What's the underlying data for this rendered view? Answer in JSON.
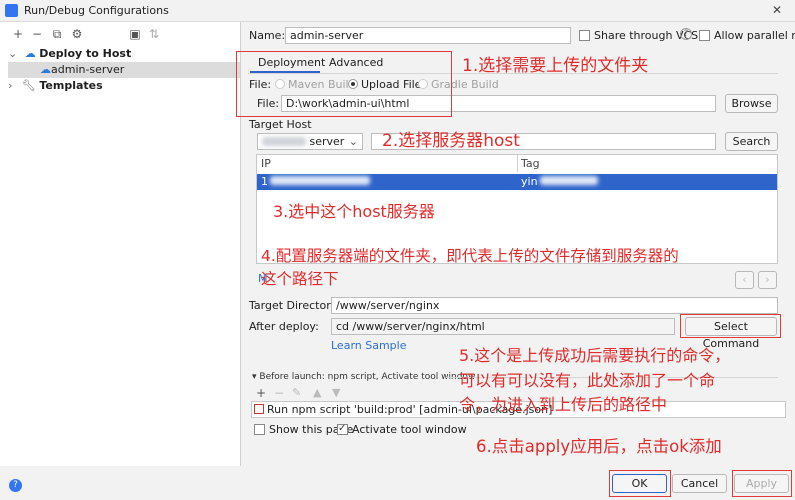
{
  "window": {
    "title": "Run/Debug Configurations",
    "close_glyph": "✕"
  },
  "toolbar": {
    "add": "+",
    "remove": "−",
    "copy": "⧉",
    "edit": "⚙",
    "folder": "▣",
    "sort": "⇅"
  },
  "tree": {
    "deploy_to_host": "Deploy to Host",
    "admin_server": "admin-server",
    "templates": "Templates"
  },
  "form": {
    "name_label": "Name:",
    "name_value": "admin-server",
    "share_vcs": "Share through VCS",
    "allow_parallel": "Allow parallel run",
    "help_glyph": "?",
    "tabs": [
      "Deployment",
      "Advanced"
    ],
    "file_label": "File:",
    "file_options": [
      "Maven Build",
      "Upload File",
      "Gradle Build"
    ],
    "file_path_label": "File:",
    "file_path_value": "D:\\work\\admin-ui\\html",
    "browse": "Browse",
    "target_host_label": "Target Host",
    "host_select_suffix": "server",
    "search": "Search",
    "table_headers": [
      "IP",
      "Tag"
    ],
    "row_ip_prefix": "1",
    "row_tag_prefix": "yin",
    "manage_link": "M",
    "target_dir_label": "Target Directory:",
    "target_dir_value": "/www/server/nginx",
    "after_deploy_label": "After deploy:",
    "after_deploy_value": "cd /www/server/nginx/html",
    "select_command": "Select Command",
    "learn_sample": "Learn Sample",
    "before_launch": "Before launch: npm script, Activate tool window",
    "npm_task": "Run npm script 'build:prod' [admin-ui\\package.json]",
    "show_page": "Show this page",
    "activate_tool": "Activate tool window"
  },
  "footer": {
    "ok": "OK",
    "cancel": "Cancel",
    "apply": "Apply",
    "help": "?"
  },
  "annotations": {
    "a1": "1.选择需要上传的文件夹",
    "a2": "2.选择服务器host",
    "a3": "3.选中这个host服务器",
    "a4_line1": "4.配置服务器端的文件夹，即代表上传的文件存储到服务器的",
    "a4_line2": "这个路径下",
    "a5_line1": "5.这个是上传成功后需要执行的命令，",
    "a5_line2": "可以有可以没有，此处添加了一个命",
    "a5_line3": "令，为进入到上传后的路径中",
    "a6": "6.点击apply应用后，点击ok添加"
  },
  "colors": {
    "annotation_red": "#e02b2b",
    "selection_blue": "#2f65ca",
    "link_blue": "#2a6fd6"
  }
}
